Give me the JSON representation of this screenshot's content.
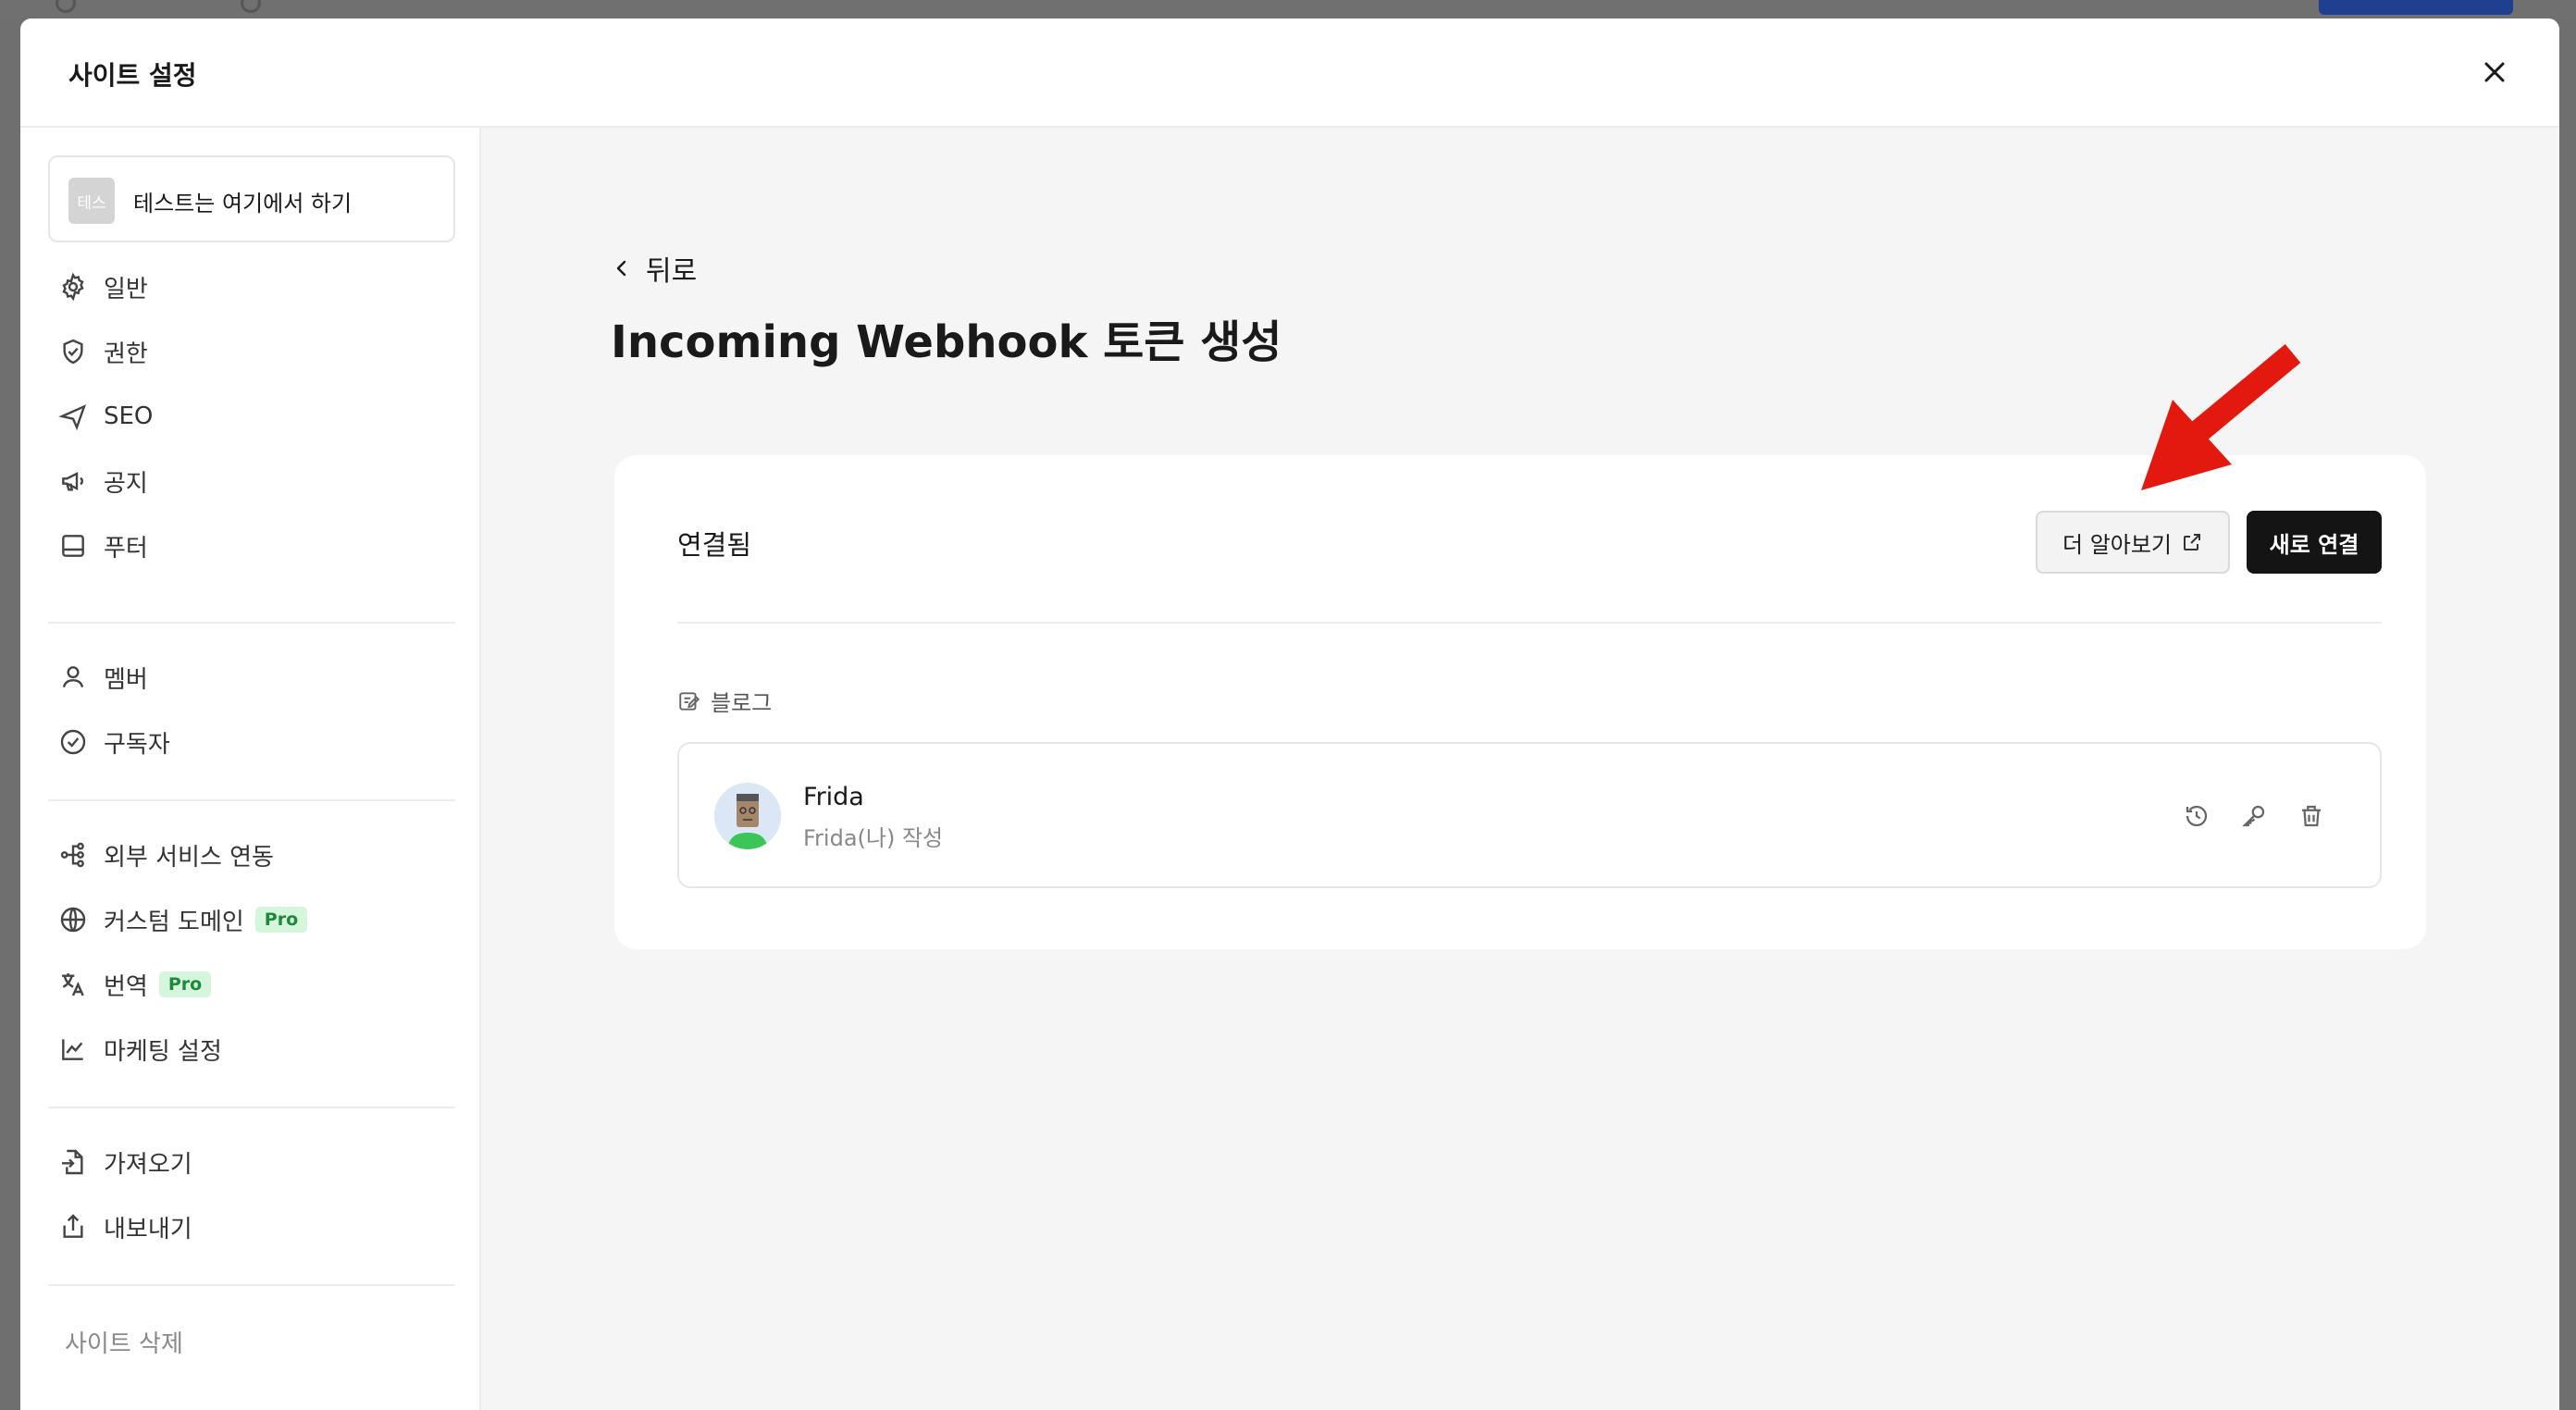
{
  "modal": {
    "title": "사이트 설정"
  },
  "sidebar": {
    "site": {
      "thumb_text": "테스",
      "name": "테스트는 여기에서 하기"
    },
    "groups": [
      [
        {
          "label": "일반",
          "icon": "gear-icon"
        },
        {
          "label": "권한",
          "icon": "shield-check-icon"
        },
        {
          "label": "SEO",
          "icon": "navigation-icon"
        },
        {
          "label": "공지",
          "icon": "megaphone-icon"
        },
        {
          "label": "푸터",
          "icon": "footer-layout-icon"
        }
      ],
      [
        {
          "label": "멤버",
          "icon": "user-icon"
        },
        {
          "label": "구독자",
          "icon": "check-circle-icon"
        }
      ],
      [
        {
          "label": "외부 서비스 연동",
          "icon": "integration-icon"
        },
        {
          "label": "커스텀 도메인",
          "icon": "globe-icon",
          "badge": "Pro"
        },
        {
          "label": "번역",
          "icon": "translate-icon",
          "badge": "Pro"
        },
        {
          "label": "마케팅 설정",
          "icon": "line-chart-icon"
        }
      ],
      [
        {
          "label": "가져오기",
          "icon": "file-import-icon"
        },
        {
          "label": "내보내기",
          "icon": "share-upload-icon"
        }
      ]
    ],
    "delete_label": "사이트 삭제"
  },
  "content": {
    "back_label": "뒤로",
    "title": "Incoming Webhook 토큰 생성",
    "card": {
      "status_label": "연결됨",
      "learn_more_label": "더 알아보기",
      "new_connection_label": "새로 연결",
      "section_label": "블로그",
      "token": {
        "name": "Frida",
        "subtitle": "Frida(나) 작성"
      }
    }
  },
  "colors": {
    "accent_dark": "#141414",
    "pro_badge_bg": "#d6f5dd",
    "pro_badge_text": "#1d8a3a",
    "annotation_arrow": "#e3190f"
  }
}
